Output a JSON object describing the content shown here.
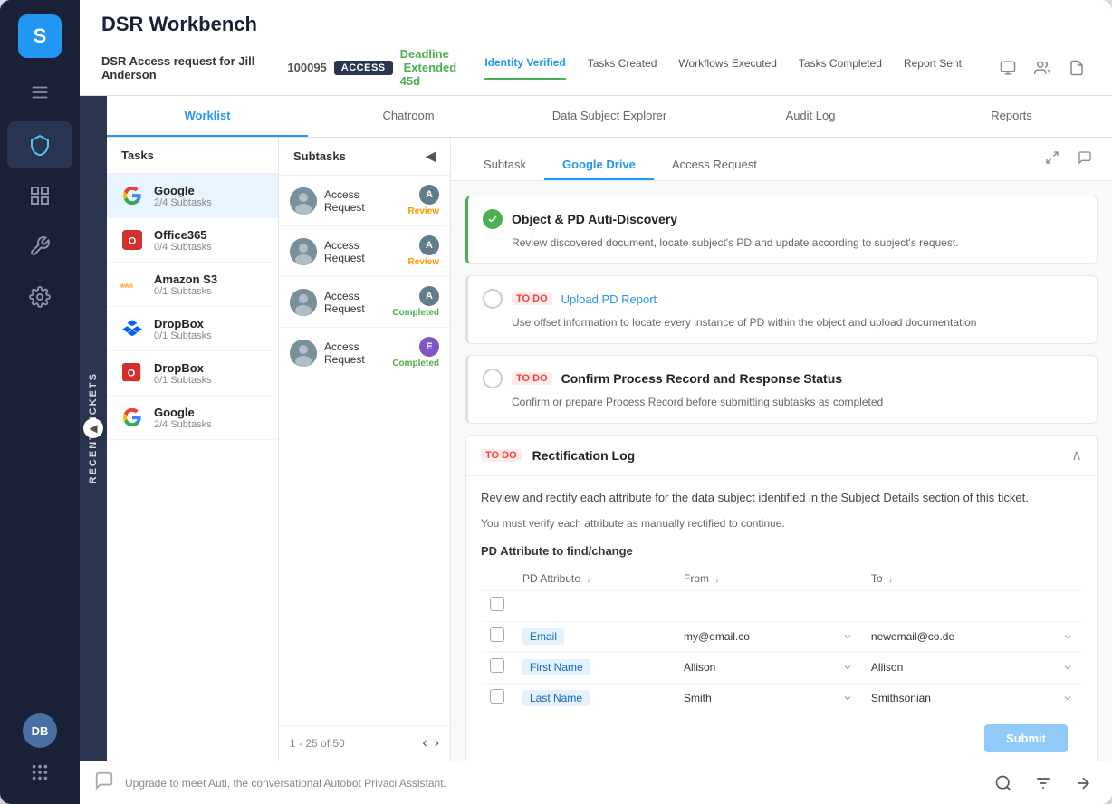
{
  "app": {
    "logo_text": "S",
    "title": "DSR Workbench"
  },
  "sidebar": {
    "nav_icons": [
      {
        "name": "menu-icon",
        "label": "Menu"
      },
      {
        "name": "shield-icon",
        "label": "Security"
      },
      {
        "name": "dashboard-icon",
        "label": "Dashboard"
      },
      {
        "name": "wrench-icon",
        "label": "Tools"
      },
      {
        "name": "gear-icon",
        "label": "Settings"
      }
    ],
    "avatar_initials": "DB",
    "recent_label": "RECENT TICKETS"
  },
  "header": {
    "title": "DSR Workbench",
    "ticket_id": "100095",
    "ticket_type": "ACCESS",
    "deadline_label": "Deadline",
    "deadline_value": "Extended 45d",
    "steps": [
      {
        "label": "Identity Verified",
        "state": "active"
      },
      {
        "label": "Tasks Created",
        "state": "done"
      },
      {
        "label": "Workflows Executed",
        "state": "done"
      },
      {
        "label": "Tasks Completed",
        "state": "done"
      },
      {
        "label": "Report Sent",
        "state": "done"
      }
    ],
    "ticket_info": "DSR Access request for Jill Anderson"
  },
  "tabs": [
    {
      "label": "Worklist",
      "active": true
    },
    {
      "label": "Chatroom",
      "active": false
    },
    {
      "label": "Data Subject Explorer",
      "active": false
    },
    {
      "label": "Audit Log",
      "active": false
    },
    {
      "label": "Reports",
      "active": false
    }
  ],
  "tasks": [
    {
      "name": "Google",
      "sub": "2/4 Subtasks",
      "logo": "google",
      "active": true
    },
    {
      "name": "Office365",
      "sub": "0/4 Subtasks",
      "logo": "office"
    },
    {
      "name": "Amazon S3",
      "sub": "0/1 Subtasks",
      "logo": "aws"
    },
    {
      "name": "DropBox",
      "sub": "0/1 Subtasks",
      "logo": "dropbox"
    },
    {
      "name": "DropBox",
      "sub": "0/1 Subtasks",
      "logo": "dropbox2"
    },
    {
      "name": "Google",
      "sub": "2/4 Subtasks",
      "logo": "google2"
    }
  ],
  "subtasks": [
    {
      "name": "Access Request",
      "badge": "A",
      "status": "Review"
    },
    {
      "name": "Access Request",
      "badge": "A",
      "status": "Review"
    },
    {
      "name": "Access Request",
      "badge": "A",
      "status": "Completed"
    },
    {
      "name": "Access Request",
      "badge": "E",
      "status": "Completed"
    }
  ],
  "pagination": {
    "label": "1 - 25 of 50"
  },
  "work_tabs": [
    {
      "label": "Subtask",
      "active": false
    },
    {
      "label": "Google Drive",
      "active": true
    },
    {
      "label": "Access Request",
      "active": false
    }
  ],
  "task_items": [
    {
      "title": "Object & PD Auti-Discovery",
      "status": "done",
      "desc": "Review discovered document, locate subject's PD and update according to subject's request."
    },
    {
      "title": "Upload PD Report",
      "status": "todo",
      "desc": "Use offset information to locate every instance of PD within the object and upload documentation"
    },
    {
      "title": "Confirm Process Record and Response Status",
      "status": "todo",
      "desc": "Confirm or prepare Process Record before submitting subtasks as completed"
    }
  ],
  "rectification": {
    "section_title": "Rectification Log",
    "todo_badge": "TO DO",
    "desc": "Review and rectify each attribute for the data subject identified in the Subject Details section of this ticket.",
    "note": "You must verify each attribute as manually rectified to continue.",
    "sub_title": "PD Attribute to find/change",
    "columns": [
      "PD Attribute",
      "From",
      "To"
    ],
    "rows": [
      {
        "attribute": "Email",
        "from": "my@email.co",
        "to": "newemail@co.de"
      },
      {
        "attribute": "First Name",
        "from": "Allison",
        "to": "Allison"
      },
      {
        "attribute": "Last Name",
        "from": "Smith",
        "to": "Smithsonian"
      }
    ],
    "submit_label": "Submit"
  },
  "bottom_bar": {
    "text": "Upgrade to meet Auti, the conversational Autobot Privaci Assistant."
  }
}
